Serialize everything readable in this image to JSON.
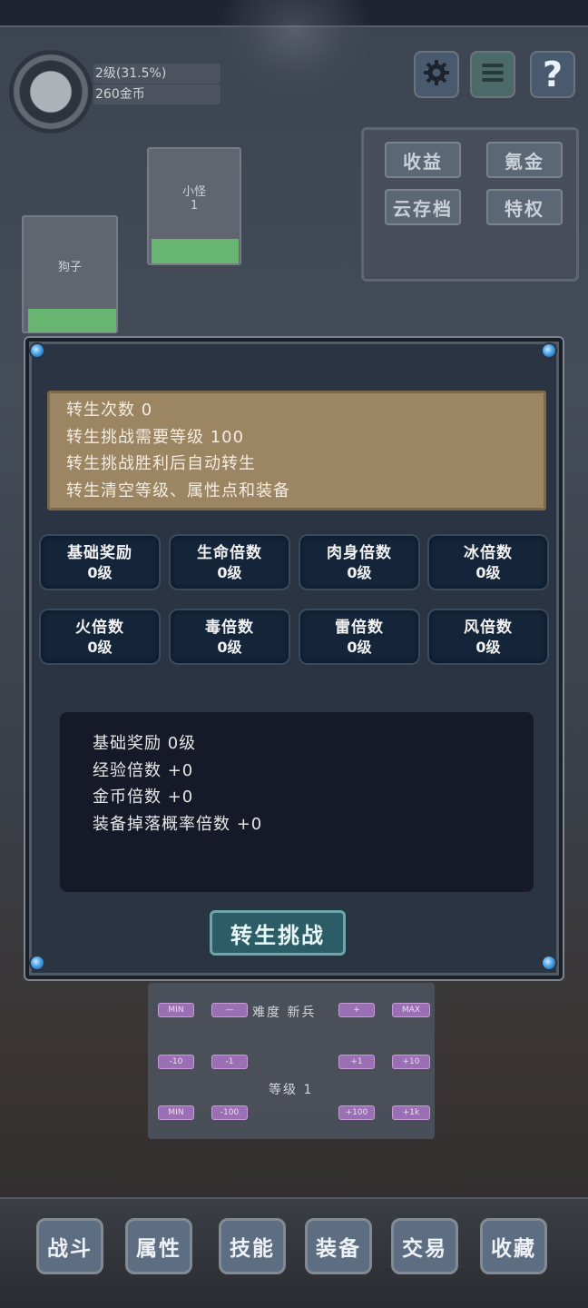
{
  "player": {
    "level_text": "2级(31.5%)",
    "gold_text": "260金币"
  },
  "top_menu": {
    "settings_icon": "gear-icon",
    "list_icon": "menu-list-icon",
    "help_label": "?"
  },
  "side_menu": {
    "items": [
      "收益",
      "氪金",
      "云存档",
      "特权"
    ]
  },
  "enemies": [
    {
      "name": "小怪",
      "count": "1",
      "hp_percent": 100
    },
    {
      "name": "狗子",
      "count": "",
      "hp_percent": 100
    }
  ],
  "rebirth": {
    "info_lines": [
      "转生次数 0",
      "转生挑战需要等级 100",
      "转生挑战胜利后自动转生",
      "转生清空等级、属性点和装备"
    ],
    "stats": [
      {
        "name": "基础奖励",
        "value": "0级"
      },
      {
        "name": "生命倍数",
        "value": "0级"
      },
      {
        "name": "肉身倍数",
        "value": "0级"
      },
      {
        "name": "冰倍数",
        "value": "0级"
      },
      {
        "name": "火倍数",
        "value": "0级"
      },
      {
        "name": "毒倍数",
        "value": "0级"
      },
      {
        "name": "雷倍数",
        "value": "0级"
      },
      {
        "name": "风倍数",
        "value": "0级"
      }
    ],
    "summary_lines": [
      "基础奖励 0级",
      "经验倍数 +0",
      "金币倍数 +0",
      "装备掉落概率倍数 +0"
    ],
    "challenge_label": "转生挑战"
  },
  "difficulty": {
    "row1": [
      "MIN",
      "—",
      "+",
      "MAX"
    ],
    "difficulty_label": "难度 新兵",
    "row2": [
      "-10",
      "-1",
      "+1",
      "+10"
    ],
    "level_label": "等级 1",
    "row3": [
      "MIN",
      "-100",
      "+100",
      "+1k"
    ]
  },
  "bottom_nav": {
    "items": [
      "战斗",
      "属性",
      "技能",
      "装备",
      "交易",
      "收藏"
    ]
  },
  "colors": {
    "hp_bar": "#67b570",
    "info_box": "#9c8562",
    "stat_cell": "#14253a",
    "challenge_button": "#2c5c66",
    "pill": "#9b6fb3"
  }
}
